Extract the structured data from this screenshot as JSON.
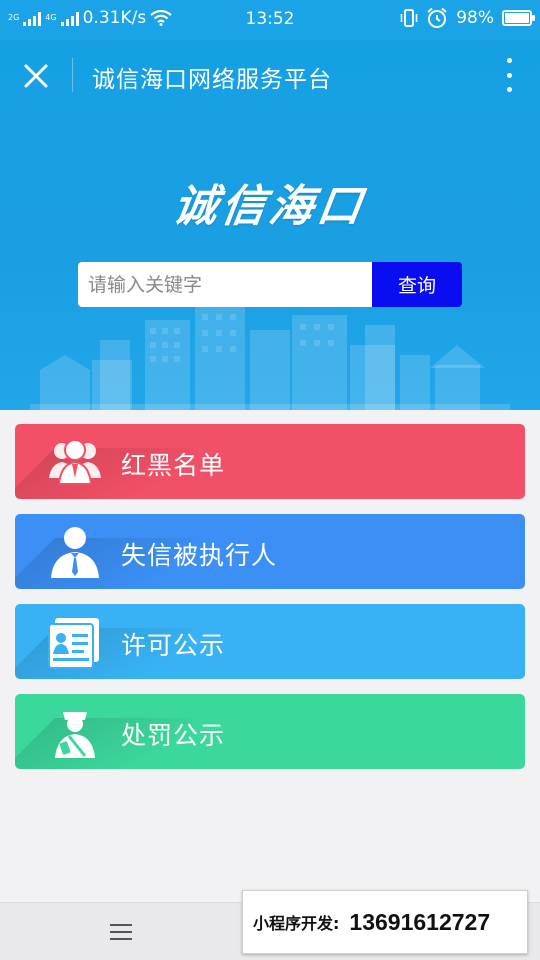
{
  "status_bar": {
    "network_tags": [
      "2G",
      "4G",
      "2G"
    ],
    "speed": "0.31K/s",
    "time": "13:52",
    "battery": "98%",
    "battery_level": 0.98,
    "icons": [
      "signal-icon",
      "wifi-icon",
      "vibrate-icon",
      "alarm-icon",
      "battery-icon"
    ]
  },
  "nav": {
    "title": "诚信海口网络服务平台",
    "close_icon": "close-icon",
    "more_icon": "more-vertical-icon"
  },
  "hero": {
    "logo_text": "诚信海口",
    "search": {
      "placeholder": "请输入关键字",
      "button": "查询"
    }
  },
  "menu": [
    {
      "label": "红黑名单",
      "icon": "group-users-icon",
      "color": "#f25066"
    },
    {
      "label": "失信被执行人",
      "icon": "person-tie-icon",
      "color": "#3b8ff5"
    },
    {
      "label": "许可公示",
      "icon": "id-card-icon",
      "color": "#38b2f4"
    },
    {
      "label": "处罚公示",
      "icon": "officer-icon",
      "color": "#3bd89c"
    }
  ],
  "bottom": {
    "menu_icon": "hamburger-icon",
    "promo_label": "小程序开发:",
    "promo_phone": "13691612727"
  },
  "colors": {
    "header": "#1aa3e6",
    "search_button": "#0a0df0",
    "background": "#f2f2f4"
  }
}
